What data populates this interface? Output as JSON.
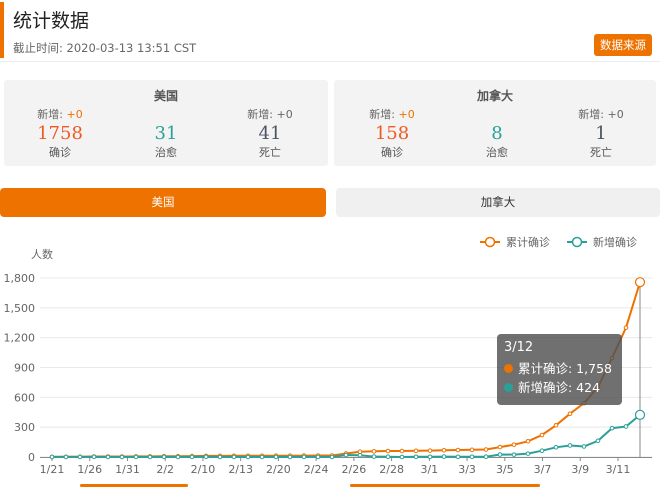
{
  "header": {
    "title": "统计数据",
    "update_time": "截止时间: 2020-03-13 13:51 CST",
    "source_button": "数据来源",
    "accent": "#ee7200"
  },
  "cards": [
    {
      "name": "美国",
      "stats": [
        {
          "inc_label": "新增:",
          "inc_value": "+0",
          "value": "1758",
          "label": "确诊"
        },
        {
          "inc_label": "",
          "inc_value": "",
          "value": "31",
          "label": "治愈"
        },
        {
          "inc_label": "新增:",
          "inc_value": "+0",
          "value": "41",
          "label": "死亡"
        }
      ]
    },
    {
      "name": "加拿大",
      "stats": [
        {
          "inc_label": "新增:",
          "inc_value": "+0",
          "value": "158",
          "label": "确诊"
        },
        {
          "inc_label": "",
          "inc_value": "",
          "value": "8",
          "label": "治愈"
        },
        {
          "inc_label": "新增:",
          "inc_value": "+0",
          "value": "1",
          "label": "死亡"
        }
      ]
    }
  ],
  "tabs": {
    "us": "美国",
    "ca": "加拿大",
    "active": "us"
  },
  "tooltip": {
    "date": "3/12",
    "rows": [
      {
        "label": "累计确诊: 1,758",
        "color": "#ee7200"
      },
      {
        "label": "新增确诊: 424",
        "color": "#2aa198"
      }
    ]
  },
  "chart_data": {
    "type": "line",
    "ylabel": "人数",
    "ylim": [
      0,
      1800
    ],
    "yticks": [
      0,
      300,
      600,
      900,
      1200,
      1500,
      1800
    ],
    "ytick_labels": [
      "0",
      "300",
      "600",
      "900",
      "1,200",
      "1,500",
      "1,800"
    ],
    "xtick_labels": [
      "1/21",
      "1/26",
      "1/31",
      "2/2",
      "2/10",
      "2/13",
      "2/20",
      "2/24",
      "2/26",
      "2/28",
      "3/1",
      "3/3",
      "3/5",
      "3/7",
      "3/9",
      "3/11"
    ],
    "legend_position": "top-right",
    "series": [
      {
        "name": "累计确诊",
        "color": "#ee7200",
        "values": [
          1,
          2,
          3,
          5,
          5,
          5,
          6,
          6,
          8,
          8,
          9,
          11,
          11,
          12,
          12,
          12,
          13,
          13,
          14,
          15,
          15,
          35,
          53,
          57,
          60,
          60,
          62,
          64,
          68,
          70,
          72,
          75,
          100,
          124,
          158,
          221,
          319,
          435,
          541,
          704,
          994,
          1301,
          1758
        ]
      },
      {
        "name": "新增确诊",
        "color": "#2aa198",
        "values": [
          1,
          1,
          1,
          2,
          0,
          0,
          1,
          0,
          2,
          0,
          1,
          2,
          0,
          1,
          0,
          0,
          1,
          0,
          1,
          1,
          0,
          20,
          18,
          4,
          3,
          0,
          2,
          2,
          4,
          2,
          2,
          3,
          25,
          24,
          34,
          63,
          98,
          116,
          106,
          163,
          290,
          307,
          424
        ]
      }
    ]
  }
}
